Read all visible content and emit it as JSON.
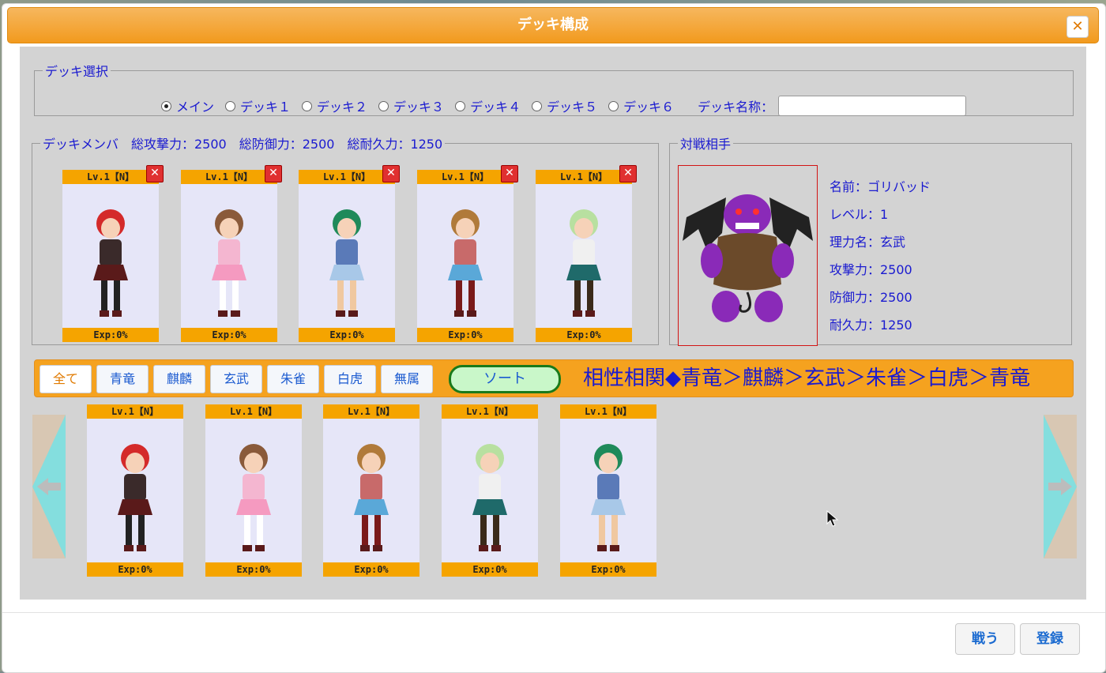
{
  "dialog": {
    "title": "デッキ構成",
    "close_icon": "close-icon"
  },
  "deck_select": {
    "legend": "デッキ選択",
    "options": [
      "メイン",
      "デッキ１",
      "デッキ２",
      "デッキ３",
      "デッキ４",
      "デッキ５",
      "デッキ６"
    ],
    "selected": "メイン",
    "name_label": "デッキ名称：",
    "name_value": ""
  },
  "deck_members": {
    "legend": "デッキメンバ　総攻撃力：2500　総防御力：2500　総耐久力：1250",
    "cards": [
      {
        "level": "Lv.1【N】",
        "exp": "Exp:0%",
        "sprite": "red-hair-girl"
      },
      {
        "level": "Lv.1【N】",
        "exp": "Exp:0%",
        "sprite": "pink-dress-girl"
      },
      {
        "level": "Lv.1【N】",
        "exp": "Exp:0%",
        "sprite": "green-hair-boy"
      },
      {
        "level": "Lv.1【N】",
        "exp": "Exp:0%",
        "sprite": "cat-girl"
      },
      {
        "level": "Lv.1【N】",
        "exp": "Exp:0%",
        "sprite": "green-hair-girl"
      }
    ]
  },
  "opponent": {
    "legend": "対戦相手",
    "sprite": "purple-demon",
    "stats": [
      "名前：ゴリバッド",
      "レベル：1",
      "理力名：玄武",
      "攻撃力：2500",
      "防御力：2500",
      "耐久力：1250"
    ]
  },
  "filters": {
    "tabs": [
      "全て",
      "青竜",
      "麒麟",
      "玄武",
      "朱雀",
      "白虎",
      "無属"
    ],
    "active": "全て",
    "sort_label": "ソート",
    "affinity": "相性相関◆青竜＞麒麟＞玄武＞朱雀＞白虎＞青竜"
  },
  "collection": {
    "cards": [
      {
        "level": "Lv.1【N】",
        "exp": "Exp:0%",
        "sprite": "red-hair-girl"
      },
      {
        "level": "Lv.1【N】",
        "exp": "Exp:0%",
        "sprite": "pink-dress-girl"
      },
      {
        "level": "Lv.1【N】",
        "exp": "Exp:0%",
        "sprite": "cat-girl"
      },
      {
        "level": "Lv.1【N】",
        "exp": "Exp:0%",
        "sprite": "green-hair-girl"
      },
      {
        "level": "Lv.1【N】",
        "exp": "Exp:0%",
        "sprite": "green-hair-boy"
      }
    ]
  },
  "footer": {
    "fight_label": "戦う",
    "register_label": "登録"
  },
  "colors": {
    "accent": "#f5a400",
    "text_blue": "#1a1ad0",
    "card_bg": "#e6e6f8"
  }
}
